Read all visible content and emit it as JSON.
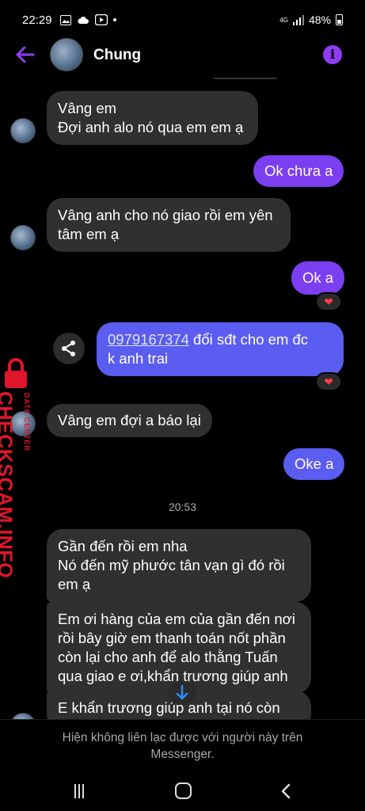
{
  "status_bar": {
    "time": "22:29",
    "signal_label": "4G",
    "battery": "48%"
  },
  "header": {
    "contact_name": "Chung",
    "info_icon": "i"
  },
  "messages": [
    {
      "side": "in",
      "lines": [
        "Vâng em",
        "Đợi anh alo nó qua em em ạ"
      ]
    },
    {
      "side": "out",
      "text": "Ok chưa a"
    },
    {
      "side": "in",
      "lines": [
        "Vâng anh cho nó giao rồi em yên",
        "tâm em ạ"
      ]
    },
    {
      "side": "out",
      "text": "Ok a",
      "reaction": "❤"
    },
    {
      "side": "out",
      "phone": "0979167374",
      "rest_line1": " đổi sđt cho em đc",
      "line2": "k anh trai",
      "reaction": "❤"
    },
    {
      "side": "in",
      "text": "Vâng em đợi a báo lại"
    },
    {
      "side": "out",
      "text": "Oke a"
    },
    {
      "side": "in",
      "lines": [
        "Gần đến rồi em nha",
        "Nó đến mỹ phước tân vạn gì đó rồi",
        "em ạ"
      ]
    },
    {
      "side": "in",
      "lines": [
        "Em ơi hàng của em của gần đến nơi",
        "rồi bây giờ em thanh toán nốt phần",
        "còn lại cho anh để alo thằng Tuấn",
        "qua giao e ơi,khẩn trương giúp anh"
      ]
    },
    {
      "side": "in",
      "text": "E khẩn trương giúp anh tại nó còn"
    }
  ],
  "timestamp": "20:53",
  "footer_notice": "Hiện không liên lạc được với người này trên Messenger.",
  "watermark": {
    "brand": "CHECKSCAM.INFO",
    "sub": "DATA CENTER"
  },
  "colors": {
    "outgoing": "#7b3ef0",
    "outgoing_alt": "#5b5cf0",
    "incoming": "#303030",
    "accent": "#8e3cf5",
    "watermark": "#e0162b"
  }
}
